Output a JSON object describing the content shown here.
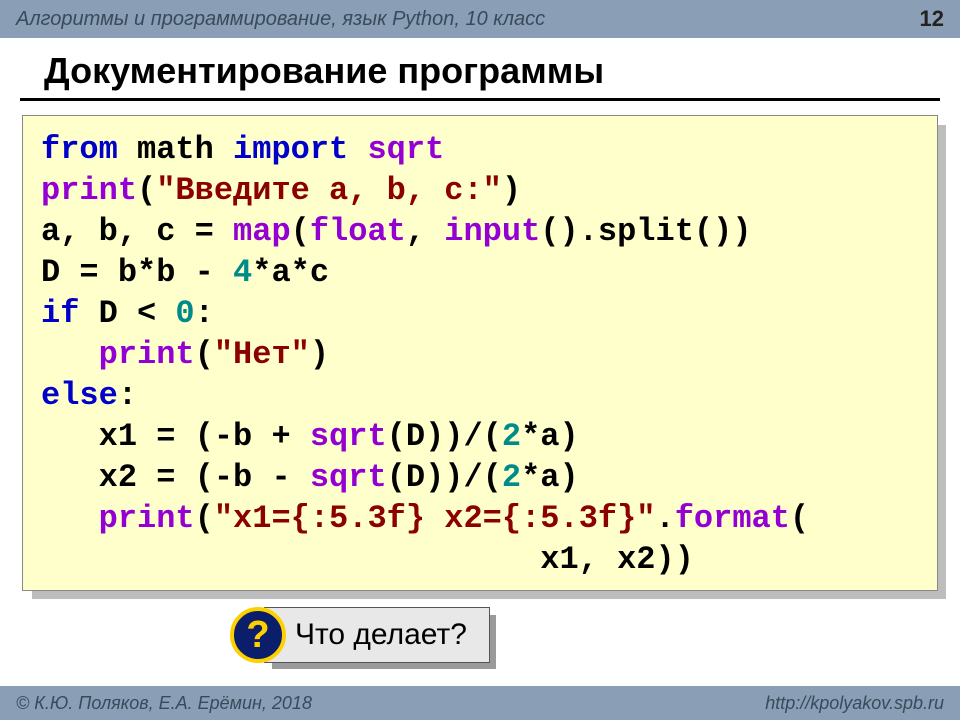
{
  "header": {
    "course": "Алгоритмы и программирование, язык Python, 10 класс",
    "page": "12"
  },
  "title": "Документирование программы",
  "code": {
    "l1": {
      "kw_from": "from",
      "mod": " math ",
      "kw_import": "import",
      "fn_sqrt": " sqrt"
    },
    "l2": {
      "fn_print": "print",
      "p1": "(",
      "str": "\"Введите a, b, c:\"",
      "p2": ")"
    },
    "l3": {
      "lhs": "a, b, c = ",
      "fn_map": "map",
      "mid1": "(",
      "fn_float": "float",
      "mid2": ", ",
      "fn_input": "input",
      "mid3": "().split())"
    },
    "l4": {
      "lhs": "D = b*b - ",
      "num4": "4",
      "rest": "*a*c"
    },
    "l5": {
      "kw_if": "if",
      "cond": " D < ",
      "num0": "0",
      "colon": ":"
    },
    "l6": {
      "indent": "   ",
      "fn_print": "print",
      "p1": "(",
      "str": "\"Нет\"",
      "p2": ")"
    },
    "l7": {
      "kw_else": "else",
      "colon": ":"
    },
    "l8": {
      "indent": "   ",
      "lhs": "x1 = (-b + ",
      "fn_sqrt": "sqrt",
      "mid": "(D))/(",
      "num2": "2",
      "rest": "*a)"
    },
    "l9": {
      "indent": "   ",
      "lhs": "x2 = (-b - ",
      "fn_sqrt": "sqrt",
      "mid": "(D))/(",
      "num2": "2",
      "rest": "*a)"
    },
    "l10": {
      "indent": "   ",
      "fn_print": "print",
      "p1": "(",
      "str": "\"x1={:5.3f} x2={:5.3f}\"",
      "dot": ".",
      "fn_format": "format",
      "p2": "("
    },
    "l11": {
      "indent": "                          ",
      "args": "x1, x2))"
    }
  },
  "callout": {
    "icon": "?",
    "text": "Что делает?"
  },
  "footer": {
    "left": "© К.Ю. Поляков, Е.А. Ерёмин, 2018",
    "right": "http://kpolyakov.spb.ru"
  }
}
